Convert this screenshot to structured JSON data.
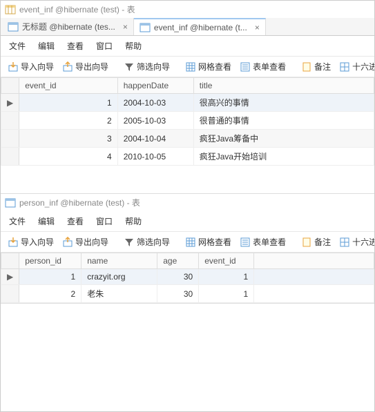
{
  "panel1": {
    "title": "event_inf @hibernate (test) - 表",
    "tabs": [
      {
        "label": "无标题 @hibernate (tes...",
        "active": false
      },
      {
        "label": "event_inf @hibernate (t...",
        "active": true
      }
    ],
    "menu": [
      "文件",
      "编辑",
      "查看",
      "窗口",
      "帮助"
    ],
    "toolbar": {
      "import": "导入向导",
      "export": "导出向导",
      "filter": "筛选向导",
      "grid": "网格查看",
      "form": "表单查看",
      "memo": "备注",
      "hex": "十六进制"
    },
    "columns": [
      "event_id",
      "happenDate",
      "title"
    ],
    "rows": [
      {
        "event_id": 1,
        "happenDate": "2004-10-03",
        "title": "很高兴的事情"
      },
      {
        "event_id": 2,
        "happenDate": "2005-10-03",
        "title": "很普通的事情"
      },
      {
        "event_id": 3,
        "happenDate": "2004-10-04",
        "title": "疯狂Java筹备中"
      },
      {
        "event_id": 4,
        "happenDate": "2010-10-05",
        "title": "疯狂Java开始培训"
      }
    ]
  },
  "panel2": {
    "title": "person_inf @hibernate (test) - 表",
    "menu": [
      "文件",
      "编辑",
      "查看",
      "窗口",
      "帮助"
    ],
    "toolbar": {
      "import": "导入向导",
      "export": "导出向导",
      "filter": "筛选向导",
      "grid": "网格查看",
      "form": "表单查看",
      "memo": "备注",
      "hex": "十六进制"
    },
    "columns": [
      "person_id",
      "name",
      "age",
      "event_id"
    ],
    "rows": [
      {
        "person_id": 1,
        "name": "crazyit.org",
        "age": 30,
        "event_id": 1
      },
      {
        "person_id": 2,
        "name": "老朱",
        "age": 30,
        "event_id": 1
      }
    ]
  }
}
